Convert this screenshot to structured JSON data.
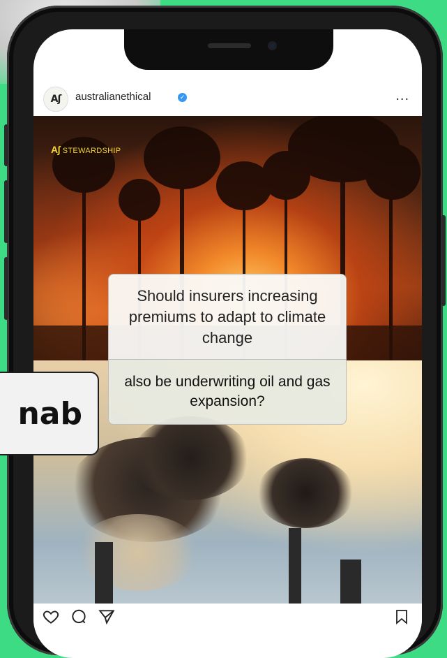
{
  "post": {
    "username": "australianethical",
    "avatar_text": "Aʃ",
    "verified_icon": "verified-badge-icon",
    "more_icon": "more-options-icon",
    "more_label": "...",
    "brand_mark": "Aʃ",
    "category": "STEWARDSHIP",
    "question_top": "Should insurers increasing premiums to adapt to climate change",
    "question_bottom": "also be underwriting oil and gas expansion?"
  },
  "actions": {
    "like_icon": "heart-icon",
    "comment_icon": "comment-icon",
    "share_icon": "send-icon",
    "save_icon": "bookmark-icon"
  },
  "overlay": {
    "text": "nab"
  },
  "colors": {
    "background": "#3ddc84",
    "tag": "#f4d630",
    "verified": "#3897f0"
  }
}
